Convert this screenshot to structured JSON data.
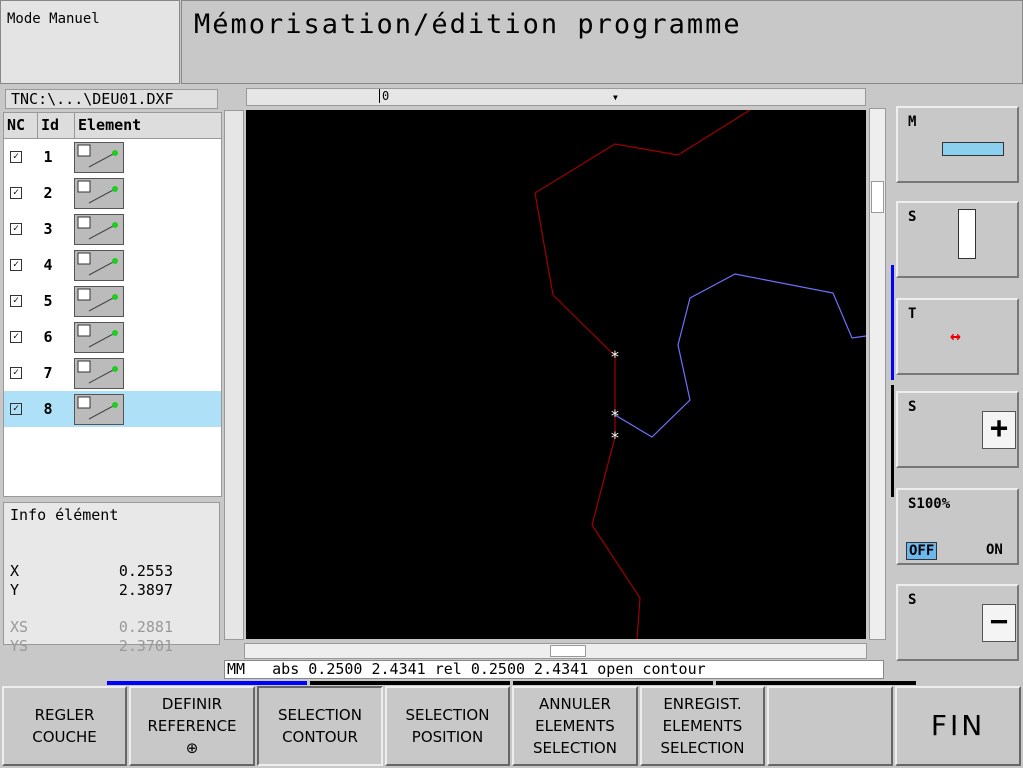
{
  "header": {
    "mode": "Mode Manuel",
    "title": "Mémorisation/édition programme"
  },
  "file_path": "TNC:\\...\\DEU01.DXF",
  "list": {
    "columns": [
      "NC",
      "Id",
      "Element"
    ],
    "rows": [
      {
        "checked": true,
        "id": "1"
      },
      {
        "checked": true,
        "id": "2"
      },
      {
        "checked": true,
        "id": "3"
      },
      {
        "checked": true,
        "id": "4"
      },
      {
        "checked": true,
        "id": "5"
      },
      {
        "checked": true,
        "id": "6"
      },
      {
        "checked": true,
        "id": "7"
      },
      {
        "checked": true,
        "id": "8",
        "selected": true
      }
    ]
  },
  "info": {
    "title": "Info élément",
    "x_label": "X",
    "x": "0.2553",
    "y_label": "Y",
    "y": "2.3897",
    "xs_label": "XS",
    "xs": "0.2881",
    "ys_label": "YS",
    "ys": "2.3701"
  },
  "ruler": {
    "origin": "0"
  },
  "status": "MM   abs 0.2500 2.4341 rel 0.2500 2.4341 open contour",
  "side_keys": {
    "m": "M",
    "s1": "S",
    "t": "T",
    "s_plus": "S",
    "s100": "S100%",
    "off": "OFF",
    "on": "ON",
    "s_minus": "S"
  },
  "softkeys": [
    [
      "REGLER",
      "COUCHE"
    ],
    [
      "DEFINIR",
      "REFERENCE"
    ],
    [
      "SELECTION",
      "CONTOUR"
    ],
    [
      "SELECTION",
      "POSITION"
    ],
    [
      "ANNULER",
      "ELEMENTS",
      "SELECTION"
    ],
    [
      "ENREGIST.",
      "ELEMENTS",
      "SELECTION"
    ],
    [],
    [
      "FIN"
    ]
  ],
  "colors": {
    "contour_selected": "#a00000",
    "contour_other": "#7070ff",
    "selection": "#aee0f7",
    "active_bar": "#0000ff"
  }
}
